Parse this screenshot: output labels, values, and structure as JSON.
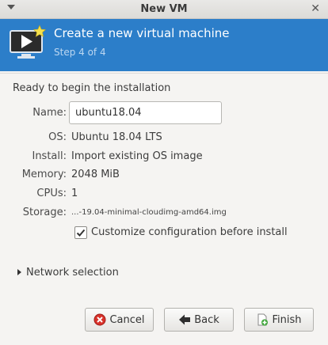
{
  "window": {
    "title": "New VM"
  },
  "banner": {
    "heading": "Create a new virtual machine",
    "step": "Step 4 of 4"
  },
  "section": {
    "title": "Ready to begin the installation"
  },
  "fields": {
    "name": {
      "label": "Name:",
      "value": "ubuntu18.04"
    },
    "os": {
      "label": "OS:",
      "value": "Ubuntu 18.04 LTS"
    },
    "install": {
      "label": "Install:",
      "value": "Import existing OS image"
    },
    "memory": {
      "label": "Memory:",
      "value": "2048 MiB"
    },
    "cpus": {
      "label": "CPUs:",
      "value": "1"
    },
    "storage": {
      "label": "Storage:",
      "value": "...-19.04-minimal-cloudimg-amd64.img"
    }
  },
  "customize": {
    "label": "Customize configuration before install",
    "checked": true
  },
  "network": {
    "label": "Network selection"
  },
  "buttons": {
    "cancel": "Cancel",
    "back": "Back",
    "finish": "Finish"
  },
  "colors": {
    "banner": "#2c7ec9",
    "banner_step_text": "#bcd7f1",
    "background": "#f5f4f2"
  },
  "icons": {
    "window_menu": "chevron-down-icon",
    "window_close": "close-icon",
    "banner": "virtual-machine-icon",
    "cancel": "cancel-icon",
    "back": "back-arrow-icon",
    "finish": "finish-icon"
  }
}
